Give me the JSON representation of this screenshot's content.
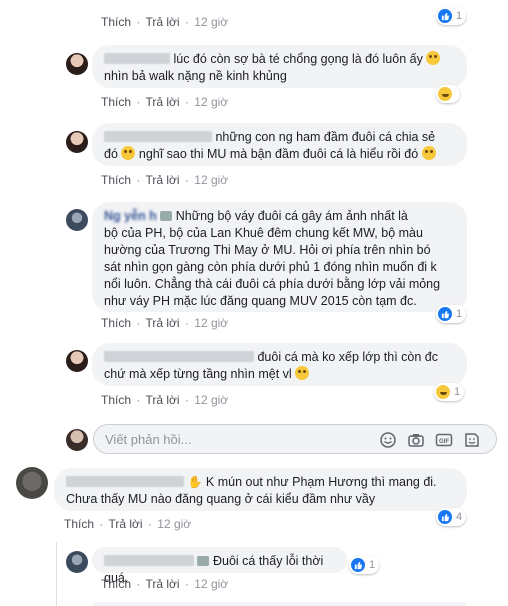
{
  "labels": {
    "like": "Thích",
    "reply": "Trả lời",
    "dot": "·"
  },
  "top_partial": {
    "time": "12 giờ",
    "reactions": "1"
  },
  "comments": [
    {
      "line1": "lúc đó còn sợ bà té chổng gọng là đó luôn ấy",
      "line2": "nhìn bả walk nặng nề kinh khủng",
      "time": "12 giờ"
    },
    {
      "line1": "những con ng ham đầm đuôi cá chia sẻ",
      "line2a": "đó",
      "line2b": "nghĩ sao thi MU mà bận đầm đuôi cá là hiểu rồi đó",
      "time": "12 giờ"
    },
    {
      "name": "Ng    yễn     h    ",
      "line1": "Những bộ váy đuôi cá gây ám ảnh nhất là",
      "line2": "bộ của PH, bộ của Lan Khuê đêm chung kết MW, bộ màu",
      "line3": "hường của Trương Thi May ở MU. Hỏi ơi phía trên nhìn bó",
      "line4": "sát nhìn gọn gàng còn phía dưới phủ 1 đóng nhìn muốn đi k",
      "line5": "nổi luôn. Chẳng thà cái đuôi cá phía dưới bằng lớp vải mỏng",
      "line6": "như váy PH mặc lúc đăng quang MUV 2015 còn tạm đc.",
      "time": "12 giờ",
      "reactions": "1"
    },
    {
      "line1": "đuôi cá mà ko xếp lớp thì còn đc",
      "line2": "chứ mà xếp từng tầng nhìn mệt vl",
      "time": "12 giờ",
      "reactions": "1"
    }
  ],
  "reply_input": {
    "placeholder": "Viết phản hồi..."
  },
  "main_comment": {
    "line1": "K mún out như Phạm Hương thì mang đi.",
    "line2": "Chưa thấy MU nào đăng quang ở cái kiểu đầm như vầy",
    "time": "12 giờ",
    "reactions": "4"
  },
  "nested_reply": {
    "text": "Đuôi cá thấy lỗi thời quá.",
    "time": "12 giờ",
    "reactions": "1"
  },
  "icons": [
    "like-icon",
    "haha-icon",
    "emoji-icon",
    "camera-icon",
    "gif-icon",
    "sticker-icon"
  ]
}
